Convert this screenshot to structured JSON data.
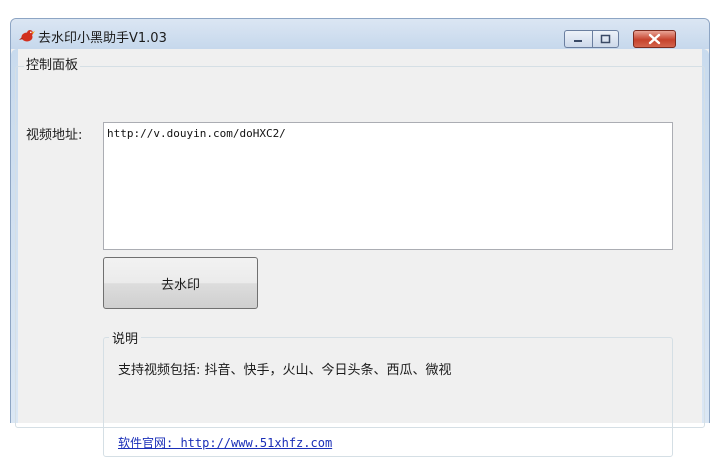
{
  "window": {
    "title": "去水印小黑助手V1.03",
    "icon": "red-bird-icon",
    "controls": {
      "minimize": "minimize-icon",
      "maximize": "maximize-icon",
      "close": "close-icon"
    }
  },
  "panel": {
    "title": "控制面板",
    "url_label": "视频地址:",
    "url_value": "http://v.douyin.com/doHXC2/",
    "action_button": "去水印"
  },
  "notes": {
    "title": "说明",
    "support_text": "支持视频包括: 抖音、快手，火山、今日头条、西瓜、微视",
    "website_link": "软件官网: http://www.51xhfz.com"
  },
  "colors": {
    "close_button": "#c6422c",
    "link": "#1a2fb8",
    "background": "#f0f0f0"
  }
}
